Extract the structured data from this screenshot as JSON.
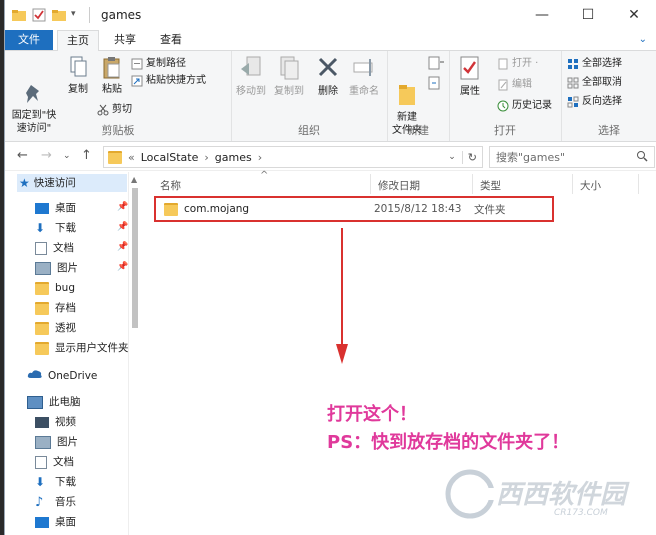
{
  "window": {
    "title": "games",
    "controls": {
      "minimize": "—",
      "maximize": "☐",
      "close": "✕"
    }
  },
  "tabs": [
    {
      "label": "文件"
    },
    {
      "label": "主页"
    },
    {
      "label": "共享"
    },
    {
      "label": "查看"
    }
  ],
  "ribbon": {
    "clipboard": {
      "group": "剪贴板",
      "pin": "固定到\"快\n速访问\"",
      "copy": "复制",
      "paste": "粘贴",
      "copy_path": "复制路径",
      "paste_shortcut": "粘贴快捷方式",
      "cut": "剪切"
    },
    "organize": {
      "group": "组织",
      "move_to": "移动到",
      "copy_to": "复制到",
      "delete": "删除",
      "rename": "重命名"
    },
    "new": {
      "group": "新建",
      "new_folder": "新建\n文件夹"
    },
    "open": {
      "group": "打开",
      "properties": "属性",
      "open": "打开 ·",
      "edit": "编辑",
      "history": "历史记录"
    },
    "select": {
      "group": "选择",
      "select_all": "全部选择",
      "select_none": "全部取消",
      "invert": "反向选择"
    }
  },
  "address": {
    "path_prefix": "«",
    "segments": [
      "LocalState",
      "games"
    ],
    "separator": "›",
    "search_placeholder": "搜索\"games\""
  },
  "sidebar": {
    "quick_access": "快速访问",
    "quick_items": [
      "桌面",
      "下载",
      "文档",
      "图片",
      "bug",
      "存档",
      "透视",
      "显示用户文件夹"
    ],
    "onedrive": "OneDrive",
    "this_pc": "此电脑",
    "pc_items": [
      "视频",
      "图片",
      "文档",
      "下载",
      "音乐",
      "桌面"
    ]
  },
  "columns": {
    "name": "名称",
    "date": "修改日期",
    "type": "类型",
    "size": "大小"
  },
  "files": [
    {
      "name": "com.mojang",
      "date": "2015/8/12 18:43",
      "type": "文件夹"
    }
  ],
  "annotation": {
    "line1": "打开这个！",
    "line2": "PS：快到放存档的文件夹了！",
    "color": "#e0399b",
    "highlight_color": "#d9312f"
  },
  "watermark": {
    "text": "西西软件园",
    "sub": "CR173.COM"
  }
}
